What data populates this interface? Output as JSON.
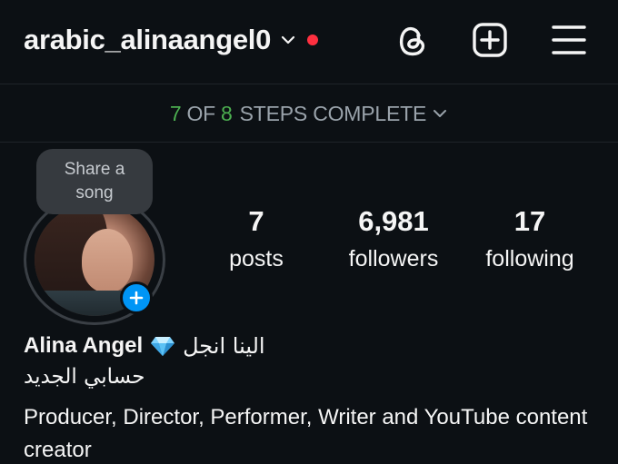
{
  "header": {
    "username": "arabic_alinaangel0",
    "icons": [
      "chevron-down-icon",
      "notification-dot",
      "threads-icon",
      "create-icon",
      "menu-icon"
    ]
  },
  "steps_banner": {
    "done": "7",
    "of": "OF",
    "total": "8",
    "label": "STEPS COMPLETE"
  },
  "profile": {
    "share_song_line1": "Share a",
    "share_song_line2": "song",
    "stats": {
      "posts_count": "7",
      "posts_label": "posts",
      "followers_count": "6,981",
      "followers_label": "followers",
      "following_count": "17",
      "following_label": "following"
    },
    "display_name": "Alina Angel",
    "arabic_name": "الينا انجل",
    "bio_arabic": "حسابي الجديد",
    "bio_text": "Producer, Director, Performer, Writer and YouTube content creator"
  },
  "colors": {
    "background": "#0c1014",
    "accent_blue": "#0095f6",
    "progress_green": "#4caf50",
    "notification_red": "#ff3040"
  }
}
